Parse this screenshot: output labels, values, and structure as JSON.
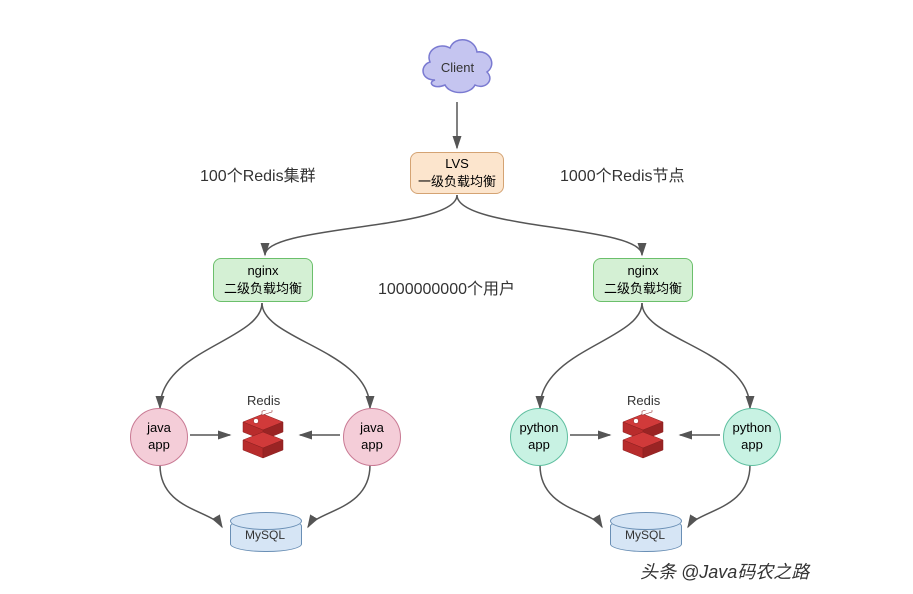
{
  "nodes": {
    "client": {
      "label": "Client"
    },
    "lvs": {
      "line1": "LVS",
      "line2": "一级负载均衡"
    },
    "nginx_left": {
      "line1": "nginx",
      "line2": "二级负载均衡"
    },
    "nginx_right": {
      "line1": "nginx",
      "line2": "二级负载均衡"
    },
    "java_left": {
      "line1": "java",
      "line2": "app"
    },
    "java_right": {
      "line1": "java",
      "line2": "app"
    },
    "python_left": {
      "line1": "python",
      "line2": "app"
    },
    "python_right": {
      "line1": "python",
      "line2": "app"
    },
    "mysql_left": {
      "label": "MySQL"
    },
    "mysql_right": {
      "label": "MySQL"
    },
    "redis_left_label": "Redis",
    "redis_right_label": "Redis"
  },
  "annotations": {
    "left": "100个Redis集群",
    "right": "1000个Redis节点",
    "center": "1000000000个用户"
  },
  "watermark": "头条 @Java码农之路",
  "colors": {
    "cloud_fill": "#c5c5f0",
    "cloud_stroke": "#7a7ad1",
    "lvs_fill": "#fce5cd",
    "lvs_stroke": "#d4a373",
    "nginx_fill": "#d4f0d4",
    "nginx_stroke": "#6bbf6b",
    "java_fill": "#f4cdd8",
    "java_stroke": "#c97a94",
    "python_fill": "#c8f2e3",
    "python_stroke": "#5fbfa0",
    "mysql_fill": "#d6e5f5",
    "mysql_stroke": "#6a8fb5",
    "redis": "#b82c2c",
    "arrow": "#555555"
  }
}
